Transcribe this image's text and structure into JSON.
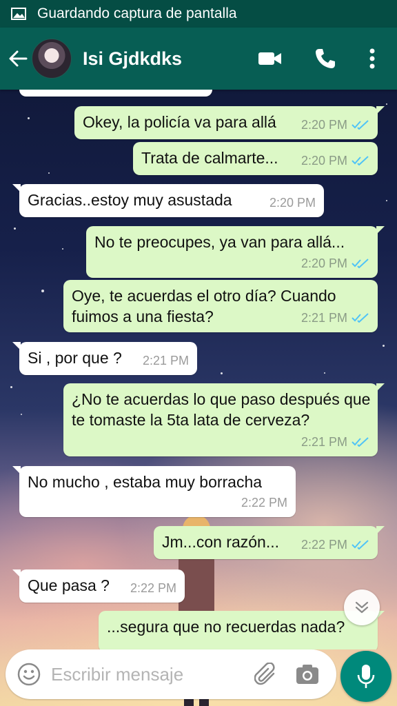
{
  "status_bar": {
    "text": "Guardando captura de pantalla",
    "icon": "image-icon"
  },
  "header": {
    "contact_name": "Isi Gjdkdks",
    "icons": [
      "back-arrow-icon",
      "video-call-icon",
      "phone-icon",
      "more-vert-icon"
    ]
  },
  "messages": [
    {
      "direction": "out",
      "text": "Okey, la policía va para allá",
      "time": "2:20 PM",
      "status": "read"
    },
    {
      "direction": "out",
      "text": "Trata de calmarte...",
      "time": "2:20 PM",
      "status": "read"
    },
    {
      "direction": "in",
      "text": "Gracias..estoy muy asustada",
      "time": "2:20 PM"
    },
    {
      "direction": "out",
      "text": "No te preocupes, ya van para allá...",
      "time": "2:20 PM",
      "status": "read"
    },
    {
      "direction": "out",
      "text": "Oye, te acuerdas el otro día? Cuando fuimos a una fiesta?",
      "time": "2:21 PM",
      "status": "read"
    },
    {
      "direction": "in",
      "text": "Si , por que ?",
      "time": "2:21 PM"
    },
    {
      "direction": "out",
      "text": "¿No te acuerdas lo que paso después que te tomaste la 5ta lata de cerveza?",
      "time": "2:21 PM",
      "status": "read"
    },
    {
      "direction": "in",
      "text": "No mucho , estaba muy borracha",
      "time": "2:22 PM"
    },
    {
      "direction": "out",
      "text": "Jm...con razón...",
      "time": "2:22 PM",
      "status": "read"
    },
    {
      "direction": "in",
      "text": "Que pasa ?",
      "time": "2:22 PM"
    },
    {
      "direction": "out",
      "text": "...segura que no recuerdas nada?",
      "time": "",
      "status": ""
    }
  ],
  "input": {
    "placeholder": "Escribir mensaje",
    "value": ""
  },
  "colors": {
    "header": "#075e54",
    "status_bar": "#054d44",
    "outgoing_bubble": "#dcf8c6",
    "incoming_bubble": "#ffffff",
    "read_tick": "#4fc3f7",
    "mic_button": "#00897b"
  }
}
